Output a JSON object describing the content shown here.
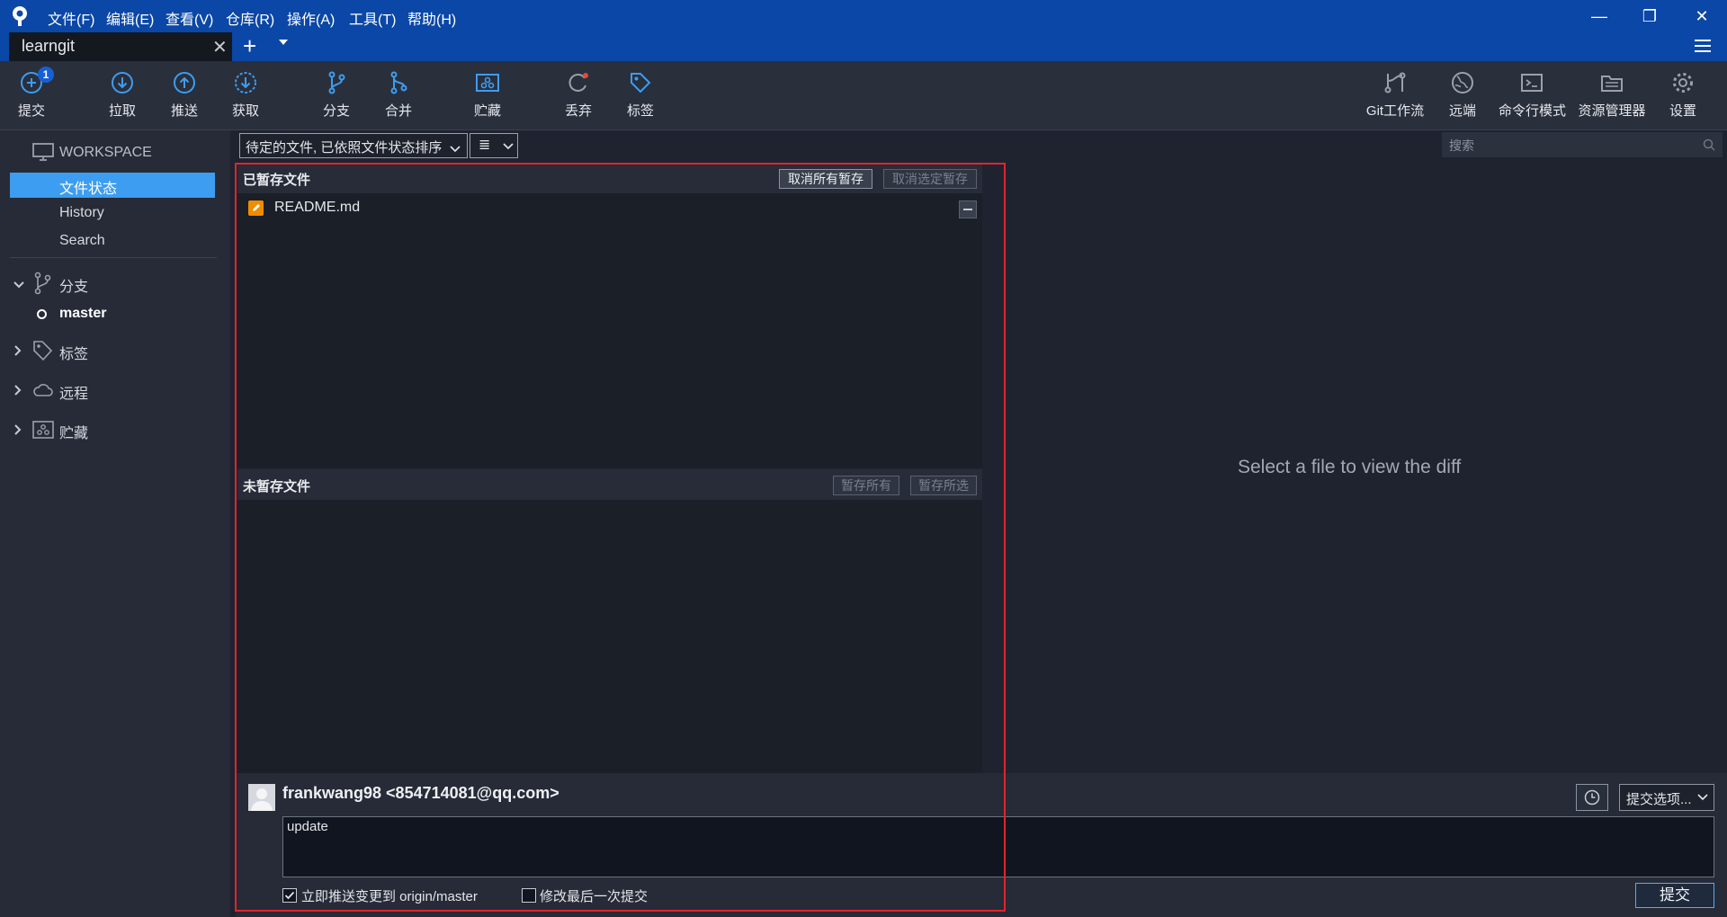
{
  "menu": [
    "文件(F)",
    "编辑(E)",
    "查看(V)",
    "仓库(R)",
    "操作(A)",
    "工具(T)",
    "帮助(H)"
  ],
  "window": {
    "minimize": "—",
    "restore": "❐",
    "close": "✕"
  },
  "tab": {
    "label": "learngit",
    "close": "✕",
    "add": "+"
  },
  "toolbar": {
    "commit": "提交",
    "commit_badge": "1",
    "pull": "拉取",
    "push": "推送",
    "fetch": "获取",
    "branch": "分支",
    "merge": "合并",
    "stash": "贮藏",
    "discard": "丢弃",
    "tag": "标签",
    "git_flow": "Git工作流",
    "remote": "远端",
    "terminal": "命令行模式",
    "explorer": "资源管理器",
    "settings": "设置"
  },
  "sidebar": {
    "workspace": "WORKSPACE",
    "nav": [
      "文件状态",
      "History",
      "Search"
    ],
    "branches": "分支",
    "current_branch": "master",
    "tags": "标签",
    "remotes": "远程",
    "stashes": "贮藏"
  },
  "filter": {
    "label": "待定的文件, 已依照文件状态排序",
    "view_icon": "≣"
  },
  "search": {
    "placeholder": "搜索"
  },
  "staged": {
    "title": "已暂存文件",
    "unstage_all": "取消所有暂存",
    "unstage_selected": "取消选定暂存",
    "files": [
      {
        "name": "README.md",
        "status": "modified"
      }
    ]
  },
  "unstaged": {
    "title": "未暂存文件",
    "stage_all": "暂存所有",
    "stage_selected": "暂存所选",
    "files": []
  },
  "diff": {
    "message": "Select a file to view the diff"
  },
  "commit": {
    "author": "frankwang98 <854714081@qq.com>",
    "options": "提交选项...",
    "message": "update",
    "push_immediately": "立即推送变更到 origin/master",
    "push_checked": true,
    "amend": "修改最后一次提交",
    "amend_checked": false,
    "submit": "提交"
  },
  "colors": {
    "accent": "#0a47a6",
    "selection": "#3d9df0",
    "highlight": "#e1252c",
    "modified": "#f08c00"
  }
}
